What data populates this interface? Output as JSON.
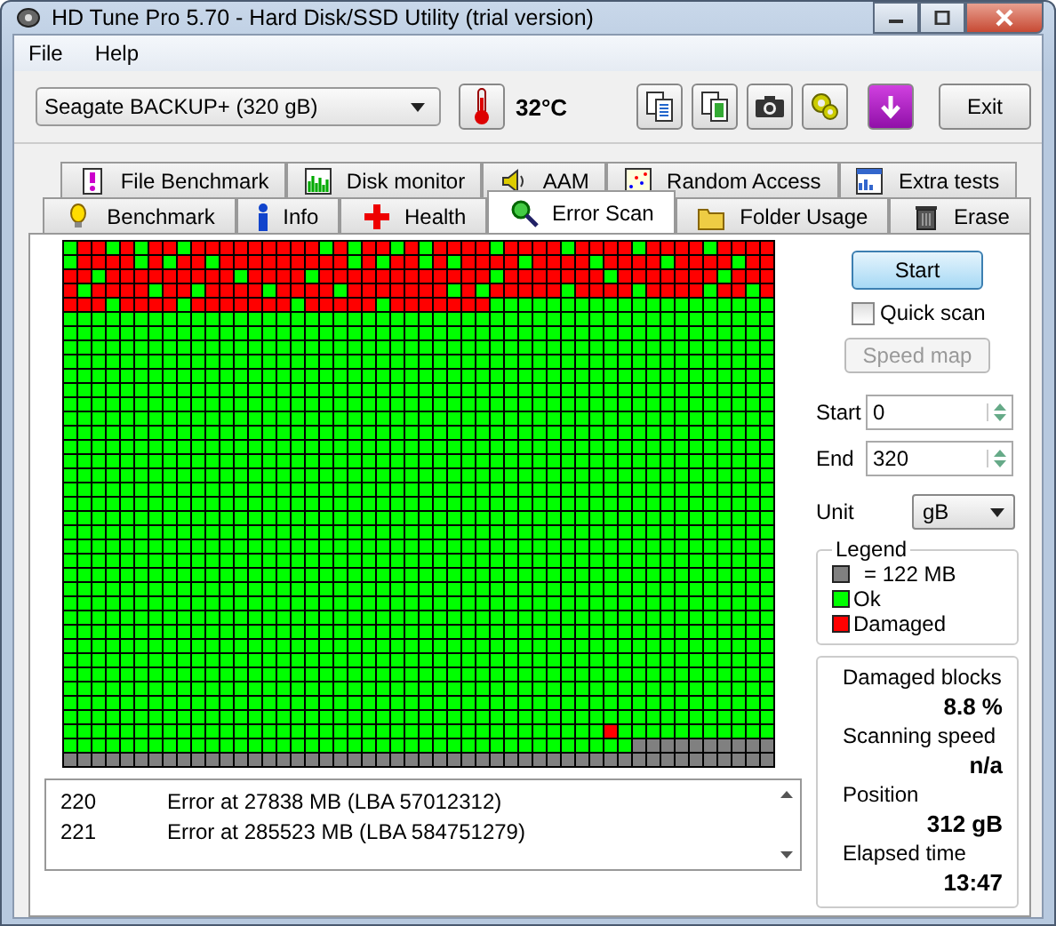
{
  "window": {
    "title": "HD Tune Pro 5.70 - Hard Disk/SSD Utility (trial version)"
  },
  "menu": [
    {
      "label": "File"
    },
    {
      "label": "Help"
    }
  ],
  "toolbar": {
    "drive": "Seagate BACKUP+ (320 gB)",
    "temperature": "32°C",
    "tools": [
      {
        "kind": "copy-text"
      },
      {
        "kind": "copy-all"
      },
      {
        "kind": "screenshot"
      },
      {
        "kind": "options"
      },
      {
        "kind": "save"
      }
    ],
    "exit": "Exit"
  },
  "tabs": [
    [
      {
        "label": "File Benchmark",
        "kind": "file",
        "selected": false
      },
      {
        "label": "Disk monitor",
        "kind": "monitor",
        "selected": false
      },
      {
        "label": "AAM",
        "kind": "speaker",
        "selected": false
      },
      {
        "label": "Random Access",
        "kind": "random",
        "selected": false
      },
      {
        "label": "Extra tests",
        "kind": "extra",
        "selected": false
      }
    ],
    [
      {
        "label": "Benchmark",
        "kind": "bulb",
        "selected": false
      },
      {
        "label": "Info",
        "kind": "info",
        "selected": false
      },
      {
        "label": "Health",
        "kind": "health",
        "selected": false
      },
      {
        "label": "Error Scan",
        "kind": "scan",
        "selected": true
      },
      {
        "label": "Folder Usage",
        "kind": "folder",
        "selected": false
      },
      {
        "label": "Erase",
        "kind": "trash",
        "selected": false
      }
    ]
  ],
  "scan_map": {
    "rows": [
      {
        "kind": "mixed",
        "damaged": [
          false,
          true,
          true,
          false,
          true,
          false,
          true,
          true,
          false,
          true,
          true,
          true,
          true,
          true,
          true,
          true,
          true,
          true,
          false,
          true,
          false,
          true,
          true,
          false,
          true,
          false,
          true,
          true,
          true,
          true,
          false,
          true,
          true,
          true,
          true,
          false,
          true,
          true,
          true,
          true,
          false,
          true,
          true,
          true,
          true,
          false,
          true,
          true,
          true,
          true
        ]
      },
      {
        "kind": "mixed",
        "damaged": [
          false,
          true,
          true,
          true,
          true,
          false,
          true,
          false,
          true,
          true,
          false,
          true,
          true,
          true,
          true,
          true,
          true,
          true,
          true,
          true,
          false,
          true,
          false,
          true,
          true,
          false,
          true,
          false,
          true,
          true,
          true,
          true,
          false,
          true,
          true,
          true,
          true,
          false,
          true,
          true,
          true,
          true,
          false,
          true,
          true,
          true,
          true,
          false,
          true,
          true
        ]
      },
      {
        "kind": "mixed",
        "damaged": [
          true,
          true,
          false,
          true,
          true,
          true,
          true,
          true,
          true,
          true,
          true,
          true,
          false,
          true,
          true,
          true,
          true,
          false,
          true,
          true,
          true,
          true,
          true,
          true,
          true,
          true,
          true,
          true,
          true,
          true,
          false,
          true,
          true,
          true,
          true,
          true,
          true,
          true,
          false,
          true,
          true,
          true,
          true,
          true,
          true,
          true,
          false,
          true,
          true,
          true
        ]
      },
      {
        "kind": "mixed",
        "damaged": [
          true,
          false,
          true,
          true,
          true,
          true,
          false,
          true,
          true,
          false,
          true,
          true,
          true,
          true,
          false,
          true,
          true,
          true,
          true,
          false,
          true,
          true,
          true,
          true,
          true,
          true,
          true,
          false,
          true,
          false,
          true,
          true,
          true,
          true,
          true,
          false,
          true,
          true,
          true,
          true,
          false,
          true,
          true,
          true,
          true,
          false,
          true,
          true,
          false,
          true
        ]
      },
      {
        "kind": "mixed",
        "damaged": [
          true,
          true,
          true,
          false,
          true,
          true,
          true,
          true,
          false,
          true,
          true,
          true,
          true,
          true,
          true,
          true,
          false,
          true,
          true,
          true,
          true,
          true,
          false,
          true,
          true,
          true,
          true,
          true,
          true,
          true,
          false,
          false,
          false,
          false,
          false,
          false,
          false,
          false,
          false,
          false,
          false,
          false,
          false,
          false,
          false,
          false,
          false,
          false,
          false,
          false
        ]
      },
      {
        "kind": "ok"
      },
      {
        "kind": "ok"
      },
      {
        "kind": "ok"
      },
      {
        "kind": "ok"
      },
      {
        "kind": "ok"
      },
      {
        "kind": "ok"
      },
      {
        "kind": "ok"
      },
      {
        "kind": "ok"
      },
      {
        "kind": "ok"
      },
      {
        "kind": "ok"
      },
      {
        "kind": "ok"
      },
      {
        "kind": "ok"
      },
      {
        "kind": "ok"
      },
      {
        "kind": "ok"
      },
      {
        "kind": "ok"
      },
      {
        "kind": "ok"
      },
      {
        "kind": "ok"
      },
      {
        "kind": "ok"
      },
      {
        "kind": "ok"
      },
      {
        "kind": "ok"
      },
      {
        "kind": "ok"
      },
      {
        "kind": "ok"
      },
      {
        "kind": "ok"
      },
      {
        "kind": "ok"
      },
      {
        "kind": "ok"
      },
      {
        "kind": "ok"
      },
      {
        "kind": "ok"
      },
      {
        "kind": "ok"
      },
      {
        "kind": "ok"
      },
      {
        "kind": "mixed",
        "damaged": [
          false,
          false,
          false,
          false,
          false,
          false,
          false,
          false,
          false,
          false,
          false,
          false,
          false,
          false,
          false,
          false,
          false,
          false,
          false,
          false,
          false,
          false,
          false,
          false,
          false,
          false,
          false,
          false,
          false,
          false,
          false,
          false,
          false,
          false,
          false,
          false,
          false,
          false,
          true,
          false,
          false,
          false,
          false,
          false,
          false,
          false,
          false,
          false,
          false,
          false
        ]
      },
      {
        "kind": "partial",
        "scanned": [
          true,
          true,
          true,
          true,
          true,
          true,
          true,
          true,
          true,
          true,
          true,
          true,
          true,
          true,
          true,
          true,
          true,
          true,
          true,
          true,
          true,
          true,
          true,
          true,
          true,
          true,
          true,
          true,
          true,
          true,
          true,
          true,
          true,
          true,
          true,
          true,
          true,
          true,
          true,
          true,
          false,
          false,
          false,
          false,
          false,
          false,
          false,
          false,
          false,
          false
        ]
      },
      {
        "kind": "unscanned"
      }
    ]
  },
  "log": [
    {
      "number": "220",
      "text": "Error at 27838 MB (LBA 57012312)"
    },
    {
      "number": "221",
      "text": "Error at 285523 MB (LBA 584751279)"
    }
  ],
  "controls": {
    "start": "Start",
    "quick_scan": {
      "label": "Quick scan",
      "checked": false
    },
    "speed_map": {
      "label": "Speed map",
      "disabled": true
    },
    "range": [
      {
        "label": "Start",
        "value": "0"
      },
      {
        "label": "End",
        "value": "320"
      }
    ],
    "unit": {
      "label": "Unit",
      "value": "gB"
    }
  },
  "legend": {
    "title": "Legend",
    "items": [
      {
        "label": "= 122 MB",
        "color": "#808080"
      },
      {
        "label": "Ok",
        "color": "#00ff00"
      },
      {
        "label": "Damaged",
        "color": "#ff0000"
      }
    ]
  },
  "stats": [
    {
      "label": "Damaged blocks",
      "value": "8.8 %"
    },
    {
      "label": "Scanning speed",
      "value": "n/a"
    },
    {
      "label": "Position",
      "value": "312 gB"
    },
    {
      "label": "Elapsed time",
      "value": "13:47"
    }
  ]
}
